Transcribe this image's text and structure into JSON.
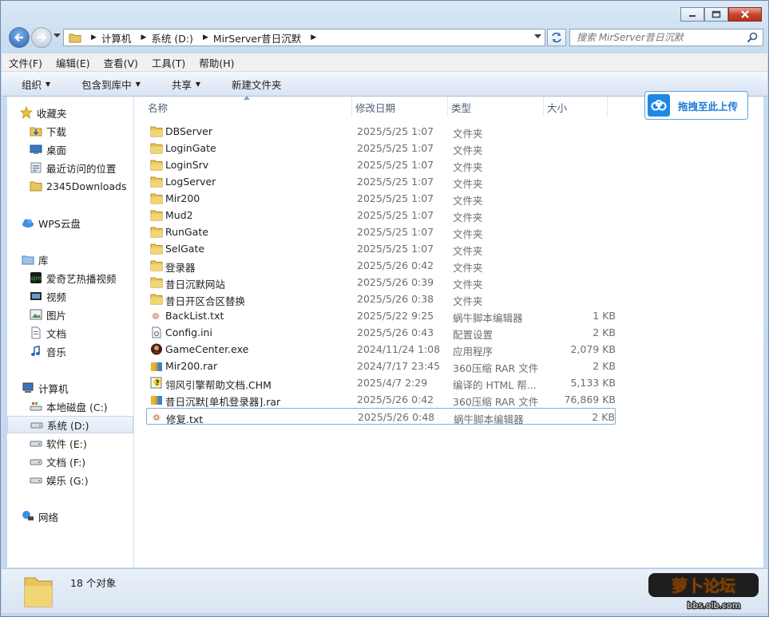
{
  "window": {
    "accent": "#2a63b4"
  },
  "address": {
    "segments": [
      "计算机",
      "系统 (D:)",
      "MirServer昔日沉默"
    ]
  },
  "search": {
    "placeholder": "搜索 MirServer昔日沉默"
  },
  "menu": [
    "文件(F)",
    "编辑(E)",
    "查看(V)",
    "工具(T)",
    "帮助(H)"
  ],
  "toolbar": {
    "organize": "组织",
    "include_library": "包含到库中",
    "share": "共享",
    "new_folder": "新建文件夹"
  },
  "upload_widget": {
    "label": "拖拽至此上传"
  },
  "nav": {
    "favorites_header": "收藏夹",
    "favorites": [
      {
        "label": "下载",
        "icon": "download-folder-icon"
      },
      {
        "label": "桌面",
        "icon": "desktop-icon"
      },
      {
        "label": "最近访问的位置",
        "icon": "recent-places-icon"
      },
      {
        "label": "2345Downloads",
        "icon": "folder-icon"
      }
    ],
    "wps": "WPS云盘",
    "library_header": "库",
    "libraries": [
      {
        "label": "爱奇艺热播视频",
        "icon": "iqiyi-icon"
      },
      {
        "label": "视频",
        "icon": "video-library-icon"
      },
      {
        "label": "图片",
        "icon": "pictures-library-icon"
      },
      {
        "label": "文档",
        "icon": "documents-library-icon"
      },
      {
        "label": "音乐",
        "icon": "music-library-icon"
      }
    ],
    "computer_header": "计算机",
    "drives": [
      {
        "label": "本地磁盘 (C:)",
        "icon": "windows-drive-icon",
        "selected": false
      },
      {
        "label": "系统 (D:)",
        "icon": "drive-icon",
        "selected": true
      },
      {
        "label": "软件 (E:)",
        "icon": "drive-icon",
        "selected": false
      },
      {
        "label": "文档 (F:)",
        "icon": "drive-icon",
        "selected": false
      },
      {
        "label": "娱乐 (G:)",
        "icon": "drive-icon",
        "selected": false
      }
    ],
    "network": "网络"
  },
  "columns": {
    "name": "名称",
    "date": "修改日期",
    "type": "类型",
    "size": "大小"
  },
  "files": [
    {
      "name": "DBServer",
      "date": "2025/5/25 1:07",
      "type": "文件夹",
      "size": "",
      "icon": "folder-icon"
    },
    {
      "name": "LoginGate",
      "date": "2025/5/25 1:07",
      "type": "文件夹",
      "size": "",
      "icon": "folder-icon"
    },
    {
      "name": "LoginSrv",
      "date": "2025/5/25 1:07",
      "type": "文件夹",
      "size": "",
      "icon": "folder-icon"
    },
    {
      "name": "LogServer",
      "date": "2025/5/25 1:07",
      "type": "文件夹",
      "size": "",
      "icon": "folder-icon"
    },
    {
      "name": "Mir200",
      "date": "2025/5/25 1:07",
      "type": "文件夹",
      "size": "",
      "icon": "folder-icon"
    },
    {
      "name": "Mud2",
      "date": "2025/5/25 1:07",
      "type": "文件夹",
      "size": "",
      "icon": "folder-icon"
    },
    {
      "name": "RunGate",
      "date": "2025/5/25 1:07",
      "type": "文件夹",
      "size": "",
      "icon": "folder-icon"
    },
    {
      "name": "SelGate",
      "date": "2025/5/25 1:07",
      "type": "文件夹",
      "size": "",
      "icon": "folder-icon"
    },
    {
      "name": "登录器",
      "date": "2025/5/26 0:42",
      "type": "文件夹",
      "size": "",
      "icon": "folder-icon"
    },
    {
      "name": "昔日沉默网站",
      "date": "2025/5/26 0:39",
      "type": "文件夹",
      "size": "",
      "icon": "folder-icon"
    },
    {
      "name": "昔日开区合区替换",
      "date": "2025/5/26 0:38",
      "type": "文件夹",
      "size": "",
      "icon": "folder-icon"
    },
    {
      "name": "BackList.txt",
      "date": "2025/5/22 9:25",
      "type": "蜗牛脚本编辑器",
      "size": "1 KB",
      "icon": "snail-script-icon"
    },
    {
      "name": "Config.ini",
      "date": "2025/5/26 0:43",
      "type": "配置设置",
      "size": "2 KB",
      "icon": "ini-config-icon"
    },
    {
      "name": "GameCenter.exe",
      "date": "2024/11/24 1:08",
      "type": "应用程序",
      "size": "2,079 KB",
      "icon": "game-exe-icon"
    },
    {
      "name": "Mir200.rar",
      "date": "2024/7/17 23:45",
      "type": "360压缩 RAR 文件",
      "size": "2 KB",
      "icon": "rar-archive-icon"
    },
    {
      "name": "翎风引擎帮助文档.CHM",
      "date": "2025/4/7 2:29",
      "type": "编译的 HTML 帮...",
      "size": "5,133 KB",
      "icon": "chm-help-icon"
    },
    {
      "name": "昔日沉默[单机登录器].rar",
      "date": "2025/5/26 0:42",
      "type": "360压缩 RAR 文件",
      "size": "76,869 KB",
      "icon": "rar-archive-icon"
    },
    {
      "name": "修复.txt",
      "date": "2025/5/26 0:48",
      "type": "蜗牛脚本编辑器",
      "size": "2 KB",
      "icon": "snail-script-icon",
      "selected": true
    }
  ],
  "status": {
    "count": "18 个对象"
  },
  "watermark": {
    "line1": "萝卜论坛",
    "line2": "bbs.olb.com"
  }
}
